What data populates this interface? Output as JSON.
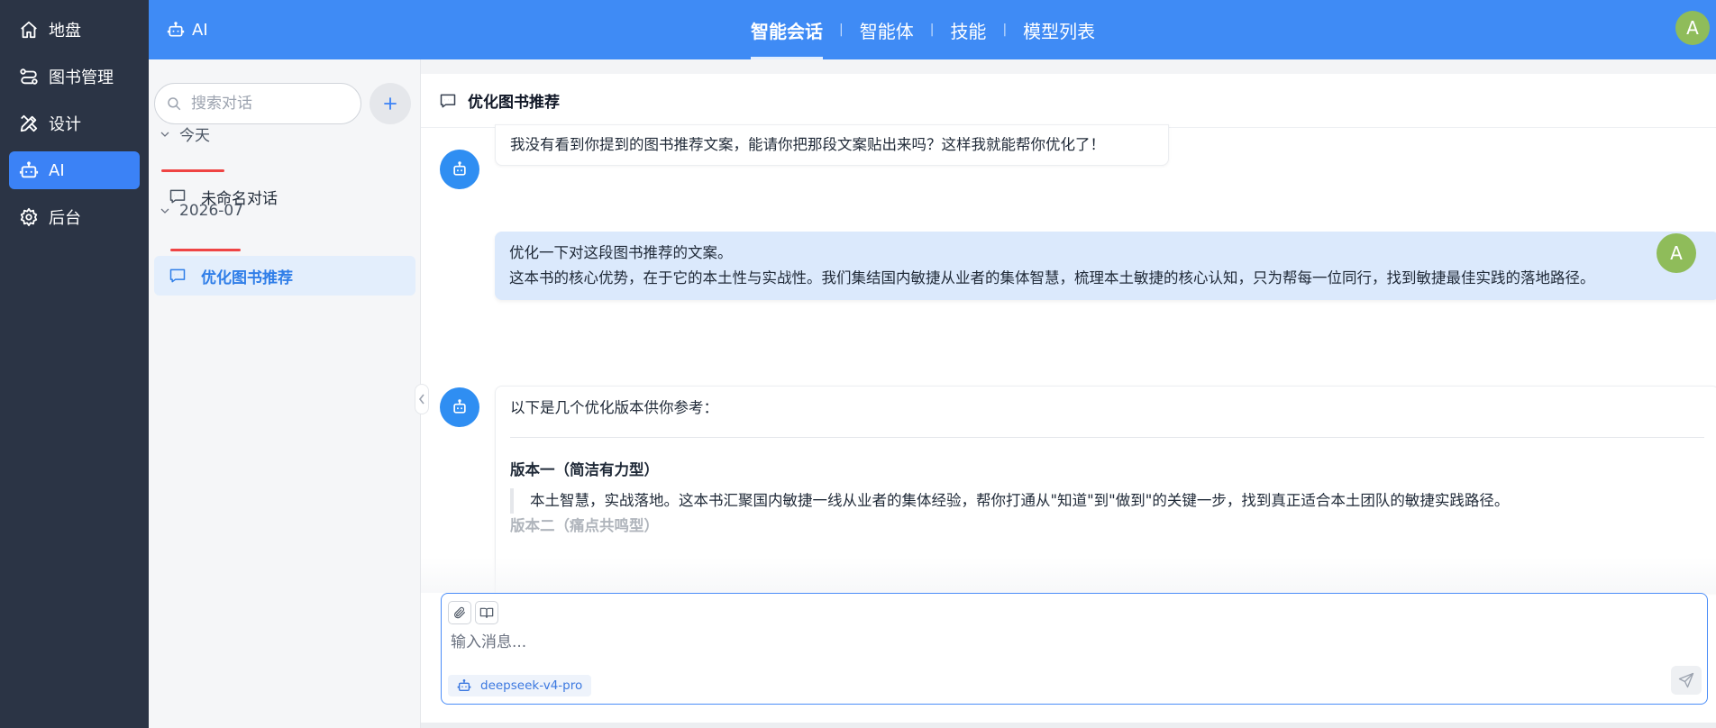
{
  "nav": {
    "items": [
      {
        "label": "地盘",
        "icon": "home-icon"
      },
      {
        "label": "图书管理",
        "icon": "route-icon"
      },
      {
        "label": "设计",
        "icon": "design-icon"
      },
      {
        "label": "AI",
        "icon": "robot-icon"
      },
      {
        "label": "后台",
        "icon": "gear-icon"
      }
    ]
  },
  "topbar": {
    "brand": "AI",
    "tabs": [
      "智能会话",
      "智能体",
      "技能",
      "模型列表"
    ],
    "avatar": "A",
    "accent": "#3f8bf5"
  },
  "convlist": {
    "search_placeholder": "搜索对话",
    "add_label": "+",
    "groups": [
      {
        "label": "今天",
        "items": [
          "未命名对话"
        ]
      },
      {
        "label": "2026-07",
        "items": [
          "优化图书推荐"
        ]
      }
    ]
  },
  "chat": {
    "title": "优化图书推荐",
    "msg1": "我没有看到你提到的图书推荐文案，能请你把那段文案贴出来吗？这样我就能帮你优化了！",
    "user_avatar": "A",
    "user_line1": "优化一下对这段图书推荐的文案。",
    "user_line2": "这本书的核心优势，在于它的本土性与实战性。我们集结国内敏捷从业者的集体智慧，梳理本土敏捷的核心认知，只为帮每一位同行，找到敏捷最佳实践的落地路径。",
    "reply_intro": "以下是几个优化版本供你参考：",
    "version1_title": "版本一（简洁有力型）",
    "version1_body": "本土智慧，实战落地。这本书汇聚国内敏捷一线从业者的集体经验，帮你打通从\"知道\"到\"做到\"的关键一步，找到真正适合本土团队的敏捷实践路径。",
    "version2_title": "版本二（痛点共鸣型）"
  },
  "composer": {
    "placeholder": "输入消息...",
    "model": "deepseek-v4-pro"
  }
}
